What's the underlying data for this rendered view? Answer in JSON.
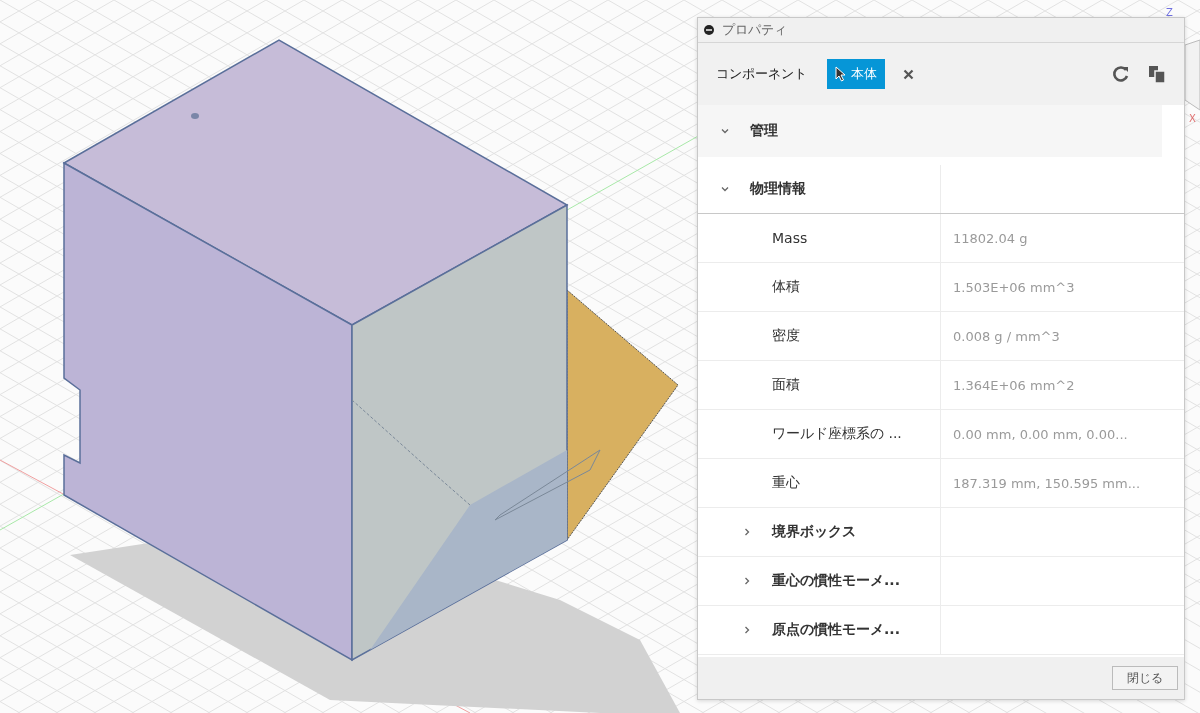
{
  "viewcube": {
    "labels": [
      "Z",
      "X"
    ]
  },
  "panel": {
    "title": "プロパティ",
    "toolbar": {
      "label": "コンポーネント",
      "selection": "本体"
    },
    "sections": [
      {
        "kind": "group",
        "label": "管理",
        "expanded": true
      },
      {
        "kind": "group",
        "label": "物理情報",
        "expanded": true,
        "children": [
          {
            "kind": "property",
            "label": "Mass",
            "value": "11802.04 g"
          },
          {
            "kind": "property",
            "label": "体積",
            "value": "1.503E+06 mm^3"
          },
          {
            "kind": "property",
            "label": "密度",
            "value": "0.008 g / mm^3"
          },
          {
            "kind": "property",
            "label": "面積",
            "value": "1.364E+06 mm^2"
          },
          {
            "kind": "property",
            "label": "ワールド座標系の ...",
            "value": "0.00 mm, 0.00 mm, 0.00..."
          },
          {
            "kind": "property",
            "label": "重心",
            "value": "187.319 mm, 150.595 mm..."
          },
          {
            "kind": "group",
            "label": "境界ボックス",
            "expanded": false
          },
          {
            "kind": "group",
            "label": "重心の慣性モーメ...",
            "expanded": false
          },
          {
            "kind": "group",
            "label": "原点の慣性モーメ...",
            "expanded": false
          }
        ]
      }
    ],
    "close_button": "閉じる"
  }
}
